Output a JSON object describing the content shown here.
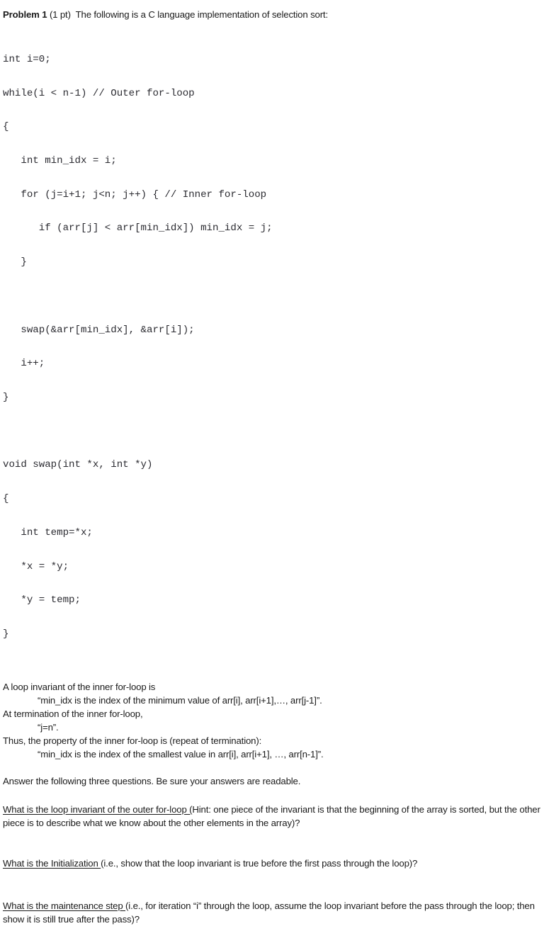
{
  "document": {
    "heading": {
      "problem_label": "Problem 1",
      "points": "(1 pt)",
      "intro": "The following is a C language implementation of selection sort:"
    },
    "code": {
      "language": "C",
      "lines": [
        "int i=0;",
        "while(i < n-1) // Outer for-loop",
        "{",
        "   int min_idx = i;",
        "   for (j=i+1; j<n; j++) { // Inner for-loop",
        "      if (arr[j] < arr[min_idx]) min_idx = j;",
        "   }",
        "",
        "   swap(&arr[min_idx], &arr[i]);",
        "   i++;",
        "}",
        "",
        "void swap(int *x, int *y)",
        "{",
        "   int temp=*x;",
        "   *x = *y;",
        "   *y = temp;",
        "}"
      ]
    },
    "invariant_section": {
      "line1": "A loop invariant of the inner for-loop is",
      "quote1": "“min_idx is the index of the minimum value of arr[i], arr[i+1],…, arr[j-1]”.",
      "line2": "At termination of the inner for-loop,",
      "quote2": "“j=n”.",
      "line3": "Thus, the property of the inner for-loop is (repeat of termination):",
      "quote3": "“min_idx is the index of the smallest value in arr[i], arr[i+1], …, arr[n-1]”."
    },
    "answer_intro": "Answer the following three questions.  Be sure your answers are readable.",
    "questions": [
      {
        "underlined": "What is the loop invariant of the outer for-loop (",
        "rest": "Hint: one piece of the invariant is that the beginning of the array is sorted, but the other piece is to describe what we know about the other elements in the array)?"
      },
      {
        "underlined": "What is the Initialization ",
        "rest": "(i.e., show that the loop invariant is true before the first pass through the loop)?"
      },
      {
        "underlined": "What is the maintenance step ",
        "rest": "(i.e., for iteration “i” through the loop, assume the loop invariant before the pass through the loop; then show it is still true after the pass)?"
      }
    ]
  }
}
